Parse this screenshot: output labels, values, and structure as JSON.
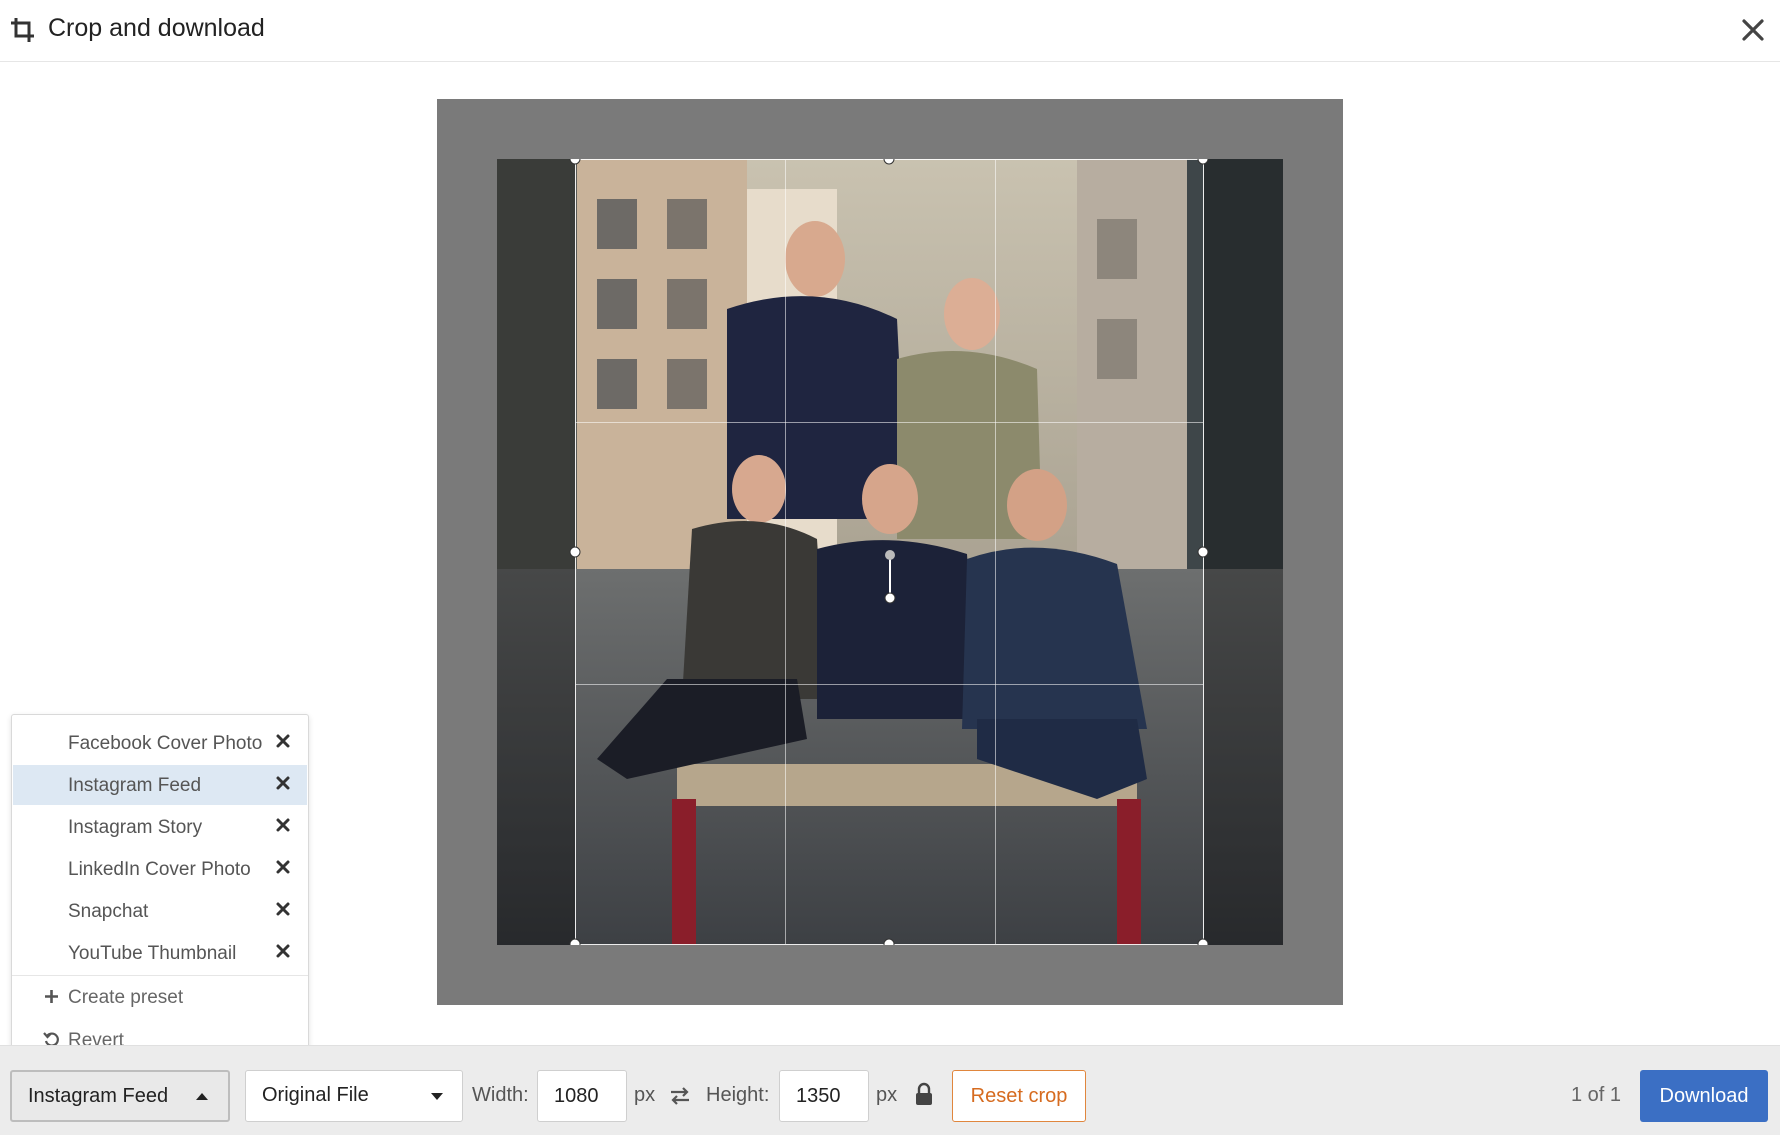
{
  "header": {
    "title": "Crop and download",
    "title_icon": "crop-icon",
    "close_icon": "close-icon"
  },
  "colors": {
    "accent_blue": "#3b6fc4",
    "reset_orange": "#d66b1f",
    "selected_bg": "#dde8f3",
    "stage_bg": "#7a7a7a"
  },
  "preset_menu": {
    "items": [
      {
        "label": "Facebook Cover Photo",
        "selected": false
      },
      {
        "label": "Instagram Feed",
        "selected": true
      },
      {
        "label": "Instagram Story",
        "selected": false
      },
      {
        "label": "LinkedIn Cover Photo",
        "selected": false
      },
      {
        "label": "Snapchat",
        "selected": false
      },
      {
        "label": "YouTube Thumbnail",
        "selected": false
      }
    ],
    "delete_icon": "delete-x-icon",
    "create_preset": "Create preset",
    "revert": "Revert"
  },
  "footer": {
    "preset_selected": "Instagram Feed",
    "format_selected": "Original File",
    "width_label": "Width:",
    "width_value": "1080",
    "height_label": "Height:",
    "height_value": "1350",
    "px_unit": "px",
    "swap_icon": "swap-arrows-icon",
    "lock_icon": "lock-icon",
    "reset_crop": "Reset crop",
    "pager": "1 of 1",
    "download": "Download"
  }
}
